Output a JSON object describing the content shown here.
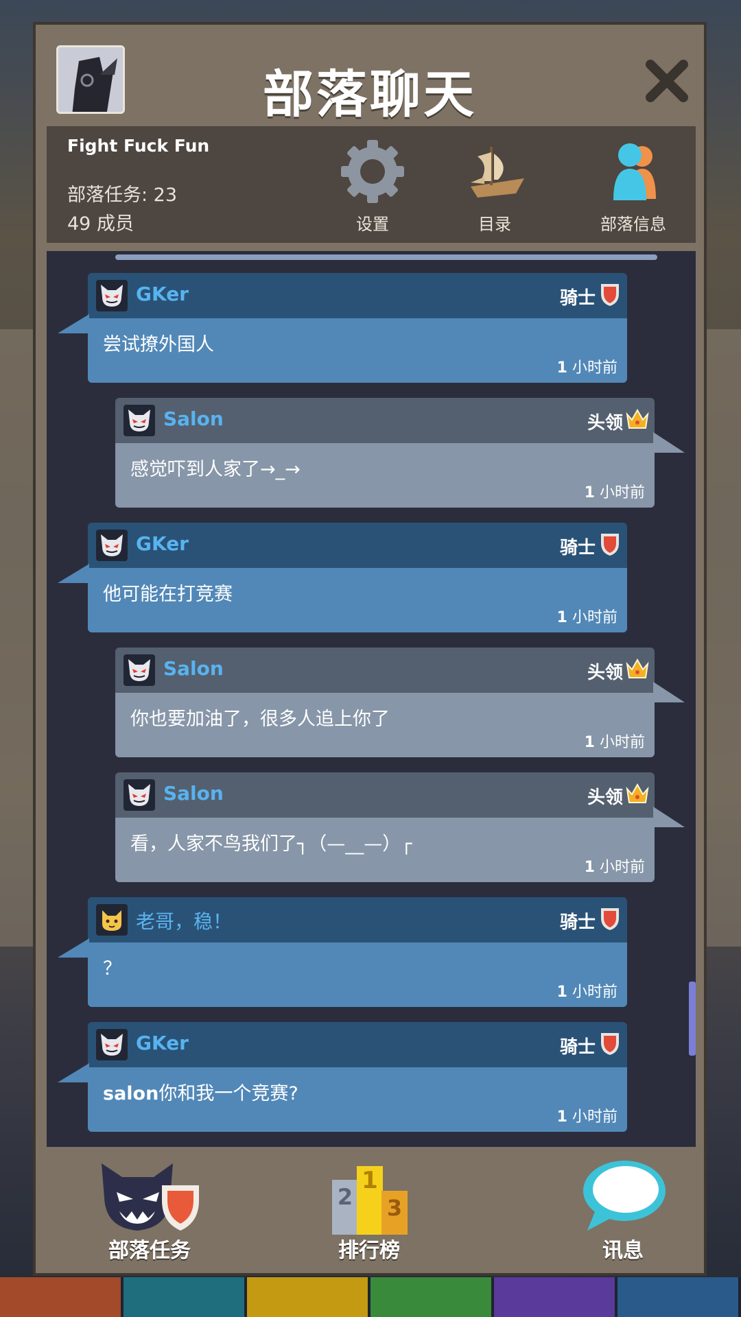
{
  "header": {
    "title": "部落聊天"
  },
  "clan": {
    "name": "Fight Fuck Fun",
    "quests_label": "部落任务: 23",
    "members_label": "49 成员"
  },
  "actions": {
    "settings": "设置",
    "directory": "目录",
    "clan_info": "部落信息"
  },
  "messages": [
    {
      "user": "GKer",
      "rank": "骑士",
      "text": "尝试撩外国人",
      "time_num": "1",
      "time_unit": "小时前",
      "style": "blue"
    },
    {
      "user": "Salon",
      "rank": "头领",
      "text": "感觉吓到人家了→_→",
      "time_num": "1",
      "time_unit": "小时前",
      "style": "gray"
    },
    {
      "user": "GKer",
      "rank": "骑士",
      "text": "他可能在打竞赛",
      "time_num": "1",
      "time_unit": "小时前",
      "style": "blue"
    },
    {
      "user": "Salon",
      "rank": "头领",
      "text": "你也要加油了，很多人追上你了",
      "time_num": "1",
      "time_unit": "小时前",
      "style": "gray"
    },
    {
      "user": "Salon",
      "rank": "头领",
      "text": "看，人家不鸟我们了┐（—__—）┌",
      "time_num": "1",
      "time_unit": "小时前",
      "style": "gray"
    },
    {
      "user": "老哥，稳！",
      "rank": "骑士",
      "text": "？",
      "time_num": "1",
      "time_unit": "小时前",
      "style": "blue"
    },
    {
      "user": "GKer",
      "rank": "骑士",
      "text_bold": "salon",
      "text": "你和我一个竞赛?",
      "time_num": "1",
      "time_unit": "小时前",
      "style": "blue"
    }
  ],
  "nav": {
    "clan_quests": "部落任务",
    "leaderboard": "排行榜",
    "messages": "讯息"
  },
  "colors": {
    "panel": "#7d7264",
    "chat_bg": "#2b2d3d",
    "blue_head": "#2a5277",
    "blue_body": "#5288b7",
    "gray_head": "#54606f",
    "gray_body": "#8796a8",
    "username": "#58b3f0"
  }
}
